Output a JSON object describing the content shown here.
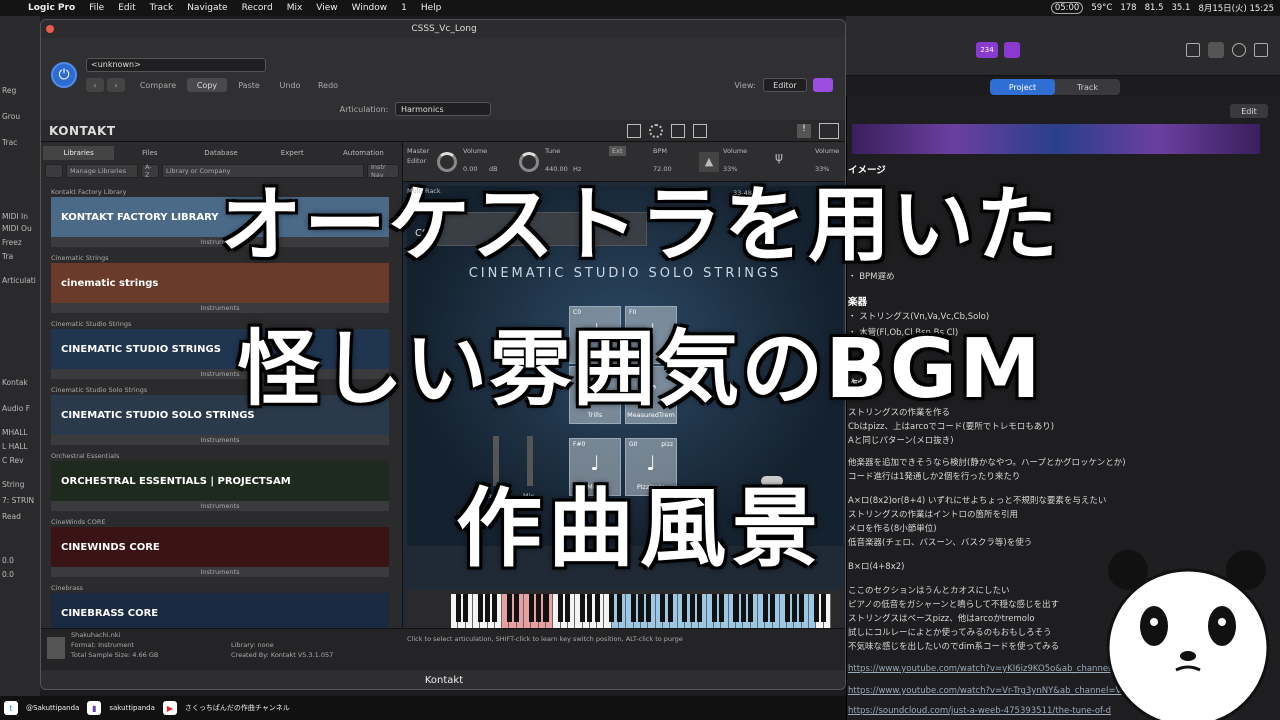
{
  "menubar": {
    "app": "Logic Pro",
    "items": [
      "File",
      "Edit",
      "Track",
      "Navigate",
      "Record",
      "Mix",
      "View",
      "Window",
      "1",
      "Help"
    ],
    "status": [
      "05:00",
      "59°C",
      "178",
      "81.5",
      "35.1",
      "8月15日(火) 15:25"
    ]
  },
  "logic_left": [
    "Reg",
    "Grou",
    "Trac",
    "MIDI In",
    "MIDI Ou",
    "Freez",
    "Tra",
    "Articulati",
    "Kontak",
    "Audio F",
    "MHALL",
    "L HALL",
    "C Rev",
    "String",
    "7: STRIN",
    "Read",
    "0.0",
    "0.0"
  ],
  "logic_right": {
    "project_tab": "Project",
    "track_tab": "Track",
    "edit": "Edit",
    "badge": "234"
  },
  "notes": [
    {
      "t": "イメージ",
      "h": true
    },
    {
      "t": "・  BPM遅め"
    },
    {
      "t": "楽器",
      "h": true
    },
    {
      "t": "・  ストリングス(Vn,Va,Vc,Cb,Solo)"
    },
    {
      "t": "・  木管(Fl,Ob,Cl,Bsn,Bs Cl)"
    },
    {
      "t": "作曲",
      "h": true
    },
    {
      "t": "ストリングスの作業を作る"
    },
    {
      "t": "Cbはpizz、上はarcoでコード(要所でトレモロもあり)"
    },
    {
      "t": "Aと同じパターン(メロ抜き)"
    },
    {
      "t": "他楽器を追加できそうなら検討(静かなやつ。ハープとかグロッケンとか)"
    },
    {
      "t": "コード進行は1発通しか2個を行ったり来たり"
    },
    {
      "t": "A×ロ(8x2)or(8+4) いずれにせよちょっと不規則な要素を与えたい"
    },
    {
      "t": "ストリングスの作業はイントロの箇所を引用"
    },
    {
      "t": "メロを作る(8小節単位)"
    },
    {
      "t": "低音楽器(チェロ、バスーン、バスクラ等)を使う"
    },
    {
      "t": "B×ロ(4+8x2)"
    },
    {
      "t": "ここのセクションはうんとカオスにしたい"
    },
    {
      "t": "ピアノの低音をガシャーンと鳴らして不穏な感じを出す"
    },
    {
      "t": "ストリングスはベースpizz、他はarcoかtremolo"
    },
    {
      "t": "試しにコルレーによとか使ってみるのもおもしろそう"
    },
    {
      "t": "不気味な感じを出したいのでdim系コードを使ってみる"
    },
    {
      "t": "https://www.youtube.com/watch?v=yKI6iz9KO5o&ab_channel=Ya",
      "link": true
    },
    {
      "t": "https://www.youtube.com/watch?v=Vr-Trg3ynNY&ab_channel=V",
      "link": true
    },
    {
      "t": "https://soundcloud.com/just-a-weeb-475393511/the-tune-of-d",
      "link": true
    }
  ],
  "kontakt": {
    "window_title": "CSSS_Vc_Long",
    "preset": "<unknown>",
    "toolbar": [
      "Compare",
      "Copy",
      "Paste",
      "Undo",
      "Redo"
    ],
    "view_label": "View:",
    "view_value": "Editor",
    "articulation_label": "Articulation:",
    "articulation_value": "Harmonics",
    "logo": "KONTAKT",
    "browser_tabs": [
      "Libraries",
      "Files",
      "Database",
      "Expert",
      "Automation"
    ],
    "manage_libraries": "Manage Libraries",
    "search_placeholder": "Library or Company",
    "instr_nav": "Instr Nav",
    "libraries": [
      {
        "cat": "Kontakt Factory Library",
        "name": "KONTAKT FACTORY LIBRARY",
        "bg": "#4a6a88",
        "ins": "Instruments"
      },
      {
        "cat": "Cinematic Strings",
        "name": "cinematic strings",
        "bg": "#6a3a2a",
        "ins": "Instruments"
      },
      {
        "cat": "Cinematic Studio Strings",
        "name": "CINEMATIC STUDIO STRINGS",
        "bg": "#1f3550",
        "ins": "Instruments"
      },
      {
        "cat": "Cinematic Studio Solo Strings",
        "name": "CINEMATIC STUDIO SOLO STRINGS",
        "bg": "#2a3a4a",
        "ins": "Instruments"
      },
      {
        "cat": "Orchestral Essentials",
        "name": "ORCHESTRAL ESSENTIALS  |  PROJECTSAM",
        "bg": "#1e2a1e",
        "ins": "Instruments"
      },
      {
        "cat": "CineWinds CORE",
        "name": "CINEWINDS CORE",
        "bg": "#3a1414",
        "ins": "Instruments"
      },
      {
        "cat": "Cinebrass",
        "name": "CINEBRASS CORE",
        "bg": "#1a2a40",
        "ins": "Instruments"
      }
    ],
    "master_editor": "Master Editor",
    "volume_label": "Volume",
    "volume_value": "0.00",
    "volume_unit": "dB",
    "tune_label": "Tune",
    "tune_value": "440.00",
    "tune_unit": "Hz",
    "ext": "Ext",
    "bpm_label": "BPM",
    "bpm_value": "72.00",
    "vol2": "33%",
    "vol3": "33%",
    "multi_rack": "Multi Rack",
    "rack_range": "33-48",
    "instrument_name": "CSSS",
    "instrument_title": "CINEMATIC STUDIO SOLO STRINGS",
    "articulations": [
      {
        "id": "C0",
        "label": "",
        "note": "♩"
      },
      {
        "id": "F0",
        "label": "",
        "note": "♩"
      },
      {
        "id": "",
        "label": "Trills",
        "note": "♪"
      },
      {
        "id": "",
        "label": "MeasuredTrem",
        "note": "♪"
      },
      {
        "id": "F#0",
        "label": "Marc",
        "note": "♩"
      },
      {
        "id": "G0",
        "label": "Pizzicato",
        "note": "♩",
        "sub": "pizz"
      }
    ],
    "faders": [
      "Room",
      "Mix"
    ],
    "con_sord": "Con sord",
    "status_file": "Shakuhachi.nki",
    "status_format": "Format: Instrument",
    "status_size": "Total Sample Size: 4.66 GB",
    "status_library": "Library: none",
    "status_created": "Created By: Kontakt V5.3.1.057",
    "status_hint": "Click to select articulation, SHIFT-click to learn key switch position, ALT-click to purge",
    "footer": "Kontakt"
  },
  "bottom": {
    "twitter": "@Sakuttipanda",
    "twitch": "sakuttipanda",
    "youtube": "さくっちぱんだの作曲チャンネル"
  },
  "overlay": {
    "line1": "オーケストラを用いた",
    "line2": "怪しい雰囲気のBGM",
    "line3": "作曲風景"
  }
}
